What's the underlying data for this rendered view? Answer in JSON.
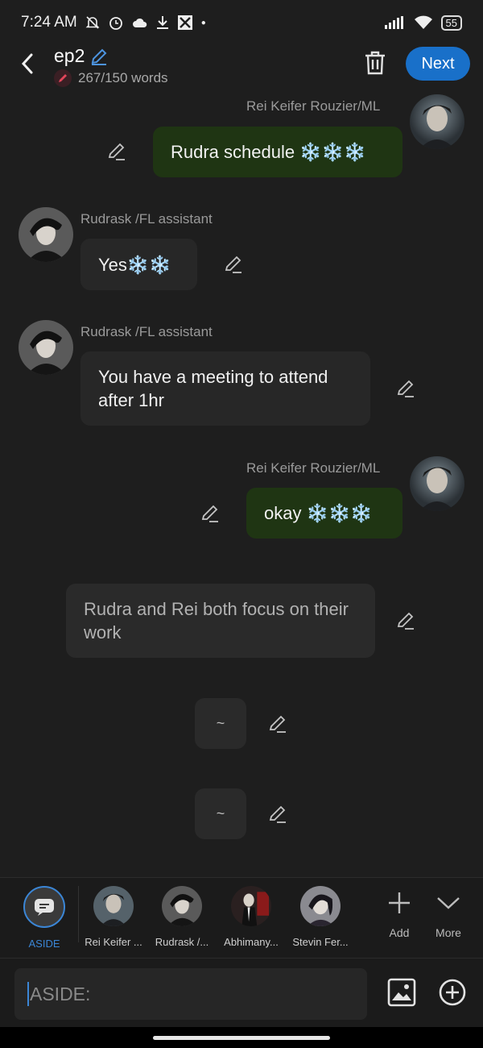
{
  "status_bar": {
    "time": "7:24 AM",
    "battery": "55"
  },
  "header": {
    "title": "ep2",
    "word_count": "267/150 words",
    "next_label": "Next"
  },
  "messages": [
    {
      "sender": "Rei Keifer Rouzier/ML",
      "text": "Rudra schedule ❄️❄️❄️"
    },
    {
      "sender": "Rudrask /FL assistant",
      "text": "Yes❄️❄️"
    },
    {
      "sender": "Rudrask /FL assistant",
      "text": "You have a meeting to attend after 1hr"
    },
    {
      "sender": "Rei Keifer Rouzier/ML",
      "text": "okay ❄️❄️❄️"
    },
    {
      "text": "Rudra and Rei both focus on their work"
    },
    {
      "text": "~"
    },
    {
      "text": "~"
    }
  ],
  "characters": [
    {
      "label": "ASIDE"
    },
    {
      "label": "Rei Keifer ..."
    },
    {
      "label": "Rudrask /..."
    },
    {
      "label": "Abhimany..."
    },
    {
      "label": "Stevin Fer..."
    }
  ],
  "tools": {
    "add_label": "Add",
    "more_label": "More"
  },
  "input": {
    "placeholder": "ASIDE:",
    "value": ""
  },
  "colors": {
    "accent": "#1970c9",
    "user_bubble": "#1f3513",
    "assistant_bubble": "#272727",
    "background": "#1e1e1e"
  },
  "icons": [
    "back-arrow-icon",
    "pencil-icon",
    "trash-icon",
    "chat-bubble-icon",
    "plus-icon",
    "chevron-down-icon",
    "image-icon",
    "add-circle-icon"
  ]
}
